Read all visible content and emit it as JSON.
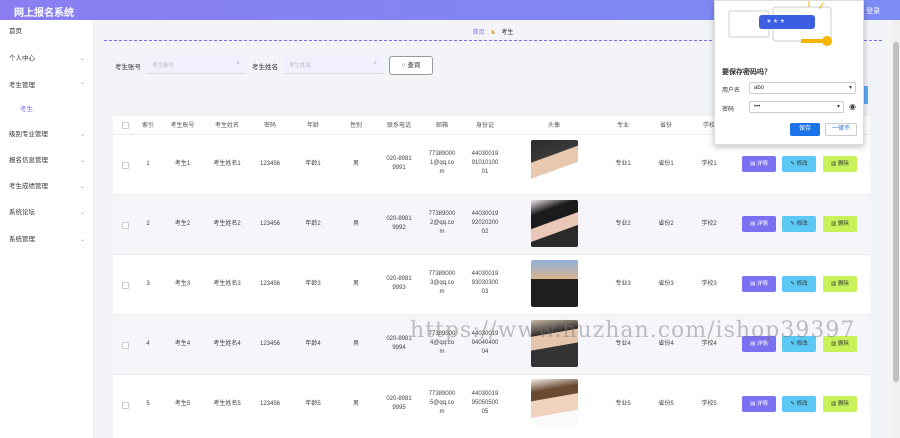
{
  "app": {
    "title": "网上报名系统",
    "login_label": "登录"
  },
  "sidebar": {
    "items": [
      {
        "label": "首页"
      },
      {
        "label": "个人中心"
      },
      {
        "label": "考生管理"
      },
      {
        "label": "考生"
      },
      {
        "label": "级别专业管理"
      },
      {
        "label": "报名信息管理"
      },
      {
        "label": "考生成绩管理"
      },
      {
        "label": "系统论坛"
      },
      {
        "label": "系统管理"
      }
    ]
  },
  "breadcrumb": {
    "home": "首页",
    "current": "考生"
  },
  "search": {
    "account_label": "考生账号",
    "account_placeholder": "考生账号",
    "name_label": "考生姓名",
    "name_placeholder": "考生姓名",
    "query_label": "查询"
  },
  "table": {
    "headers": [
      "索引",
      "考生账号",
      "考生姓名",
      "密码",
      "年龄",
      "性别",
      "联系电话",
      "邮箱",
      "身份证",
      "头像",
      "专业",
      "省份",
      "学校"
    ],
    "rows": [
      {
        "index": "1",
        "account": "考生1",
        "name": "考生姓名1",
        "password": "123456",
        "age": "年龄1",
        "gender": "男",
        "phone": [
          "020-8981",
          "9991"
        ],
        "email": [
          "77389000",
          "1@qq.co",
          "m"
        ],
        "idcard": [
          "44030019",
          "91010100",
          "01"
        ],
        "major": "专业1",
        "province": "省份1",
        "school": "学校1"
      },
      {
        "index": "2",
        "account": "考生2",
        "name": "考生姓名2",
        "password": "123456",
        "age": "年龄2",
        "gender": "男",
        "phone": [
          "020-8981",
          "9992"
        ],
        "email": [
          "77389000",
          "2@qq.co",
          "m"
        ],
        "idcard": [
          "44030019",
          "92020200",
          "02"
        ],
        "major": "专业2",
        "province": "省份2",
        "school": "学校2"
      },
      {
        "index": "3",
        "account": "考生3",
        "name": "考生姓名3",
        "password": "123456",
        "age": "年龄3",
        "gender": "男",
        "phone": [
          "020-8981",
          "9993"
        ],
        "email": [
          "77389000",
          "3@qq.co",
          "m"
        ],
        "idcard": [
          "44030019",
          "93030300",
          "03"
        ],
        "major": "专业3",
        "province": "省份3",
        "school": "学校3"
      },
      {
        "index": "4",
        "account": "考生4",
        "name": "考生姓名4",
        "password": "123456",
        "age": "年龄4",
        "gender": "男",
        "phone": [
          "020-8981",
          "9994"
        ],
        "email": [
          "77389000",
          "4@qq.co",
          "m"
        ],
        "idcard": [
          "44030019",
          "94040400",
          "04"
        ],
        "major": "专业4",
        "province": "省份4",
        "school": "学校4"
      },
      {
        "index": "5",
        "account": "考生5",
        "name": "考生姓名5",
        "password": "123456",
        "age": "年龄5",
        "gender": "男",
        "phone": [
          "020-8981",
          "9995"
        ],
        "email": [
          "77389000",
          "5@qq.co",
          "m"
        ],
        "idcard": [
          "44030019",
          "95050500",
          "05"
        ],
        "major": "专业5",
        "province": "省份5",
        "school": "学校5"
      }
    ],
    "actions": {
      "detail": "详情",
      "edit": "修改",
      "delete": "删除"
    }
  },
  "password_popup": {
    "question": "要保存密码吗？",
    "username_label": "用户名",
    "username_value": "abo",
    "password_label": "密码",
    "password_value": "•••",
    "save_label": "保存",
    "never_label": "一律不"
  },
  "watermark": "https://www.huzhan.com/ishop39397",
  "colors": {
    "accent": "#7b6ff2",
    "topbar": "#8a7df2",
    "edit": "#5bc8f5",
    "delete": "#c8f25a",
    "save": "#1a73e8"
  }
}
